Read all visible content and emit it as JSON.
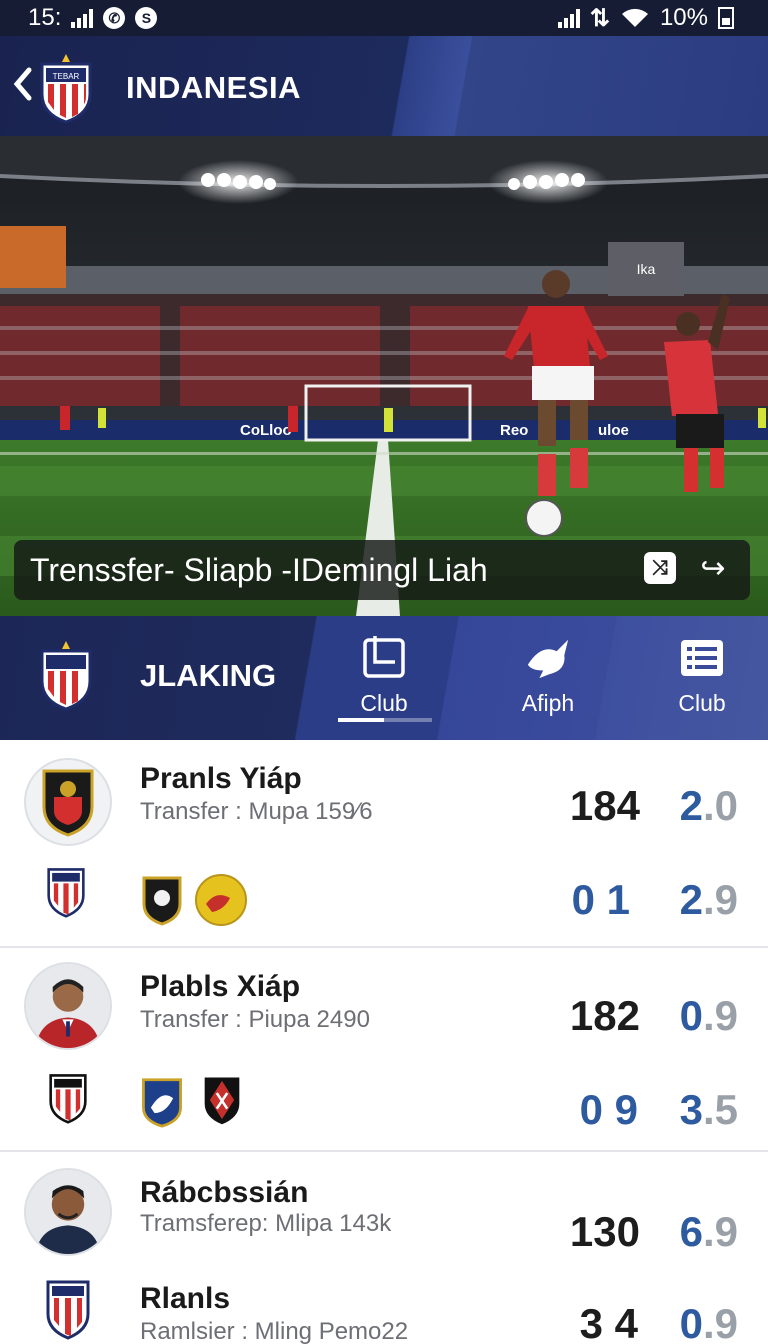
{
  "status_bar": {
    "time": "15:",
    "battery": "10%",
    "left_icons": [
      "signal-icon",
      "whatsapp-icon",
      "shazam-icon"
    ],
    "right_icons": [
      "signal-icon",
      "data-icon",
      "wifi-icon",
      "battery-icon"
    ]
  },
  "header": {
    "title": "INDANESIA",
    "crest_text": "TEBAR"
  },
  "hero": {
    "caption": "Trenssfer- Sliapb -IDemingl Liah",
    "board_left": "CoLloo",
    "board_right": "Reo",
    "board_far_right": "uloe",
    "screen_text": "Ika"
  },
  "tabbar": {
    "league": "JLAKING",
    "tabs": [
      {
        "label": "Club",
        "icon": "club-card-icon",
        "active": true
      },
      {
        "label": "Afiph",
        "icon": "bird-icon",
        "active": false
      },
      {
        "label": "Club",
        "icon": "list-icon",
        "active": false
      }
    ]
  },
  "players": [
    {
      "name": "Pranls Yiáp",
      "sub": "Transfer : Mupa 159⁄6",
      "stat_a": "184",
      "stat_b_main": "2",
      "stat_b_dec": ".0",
      "row2_a": "0 1",
      "row2_b_main": "2",
      "row2_b_dec": ".9"
    },
    {
      "name": "Plabls Xiáp",
      "sub": "Transfer : Piupa 2490",
      "stat_a": "182",
      "stat_b_main": "0",
      "stat_b_dec": ".9",
      "row2_a": "0 9",
      "row2_b_main": "3",
      "row2_b_dec": ".5"
    },
    {
      "name": "Rábcbssián",
      "sub": "Tramsferep: Mlipa 143k",
      "stat_a": "130",
      "stat_b_main": "6",
      "stat_b_dec": ".9",
      "name2": "Rlanls",
      "sub2": "Ramlsier : Mling Pemo22",
      "row2_a": "3 4",
      "row2_b_main": "0",
      "row2_b_dec": ".9"
    }
  ],
  "colors": {
    "header_navy": "#1a2350",
    "accent_blue": "#2e5aa0",
    "crest_red": "#d32f2f",
    "pitch_green": "#3f7a2c"
  }
}
